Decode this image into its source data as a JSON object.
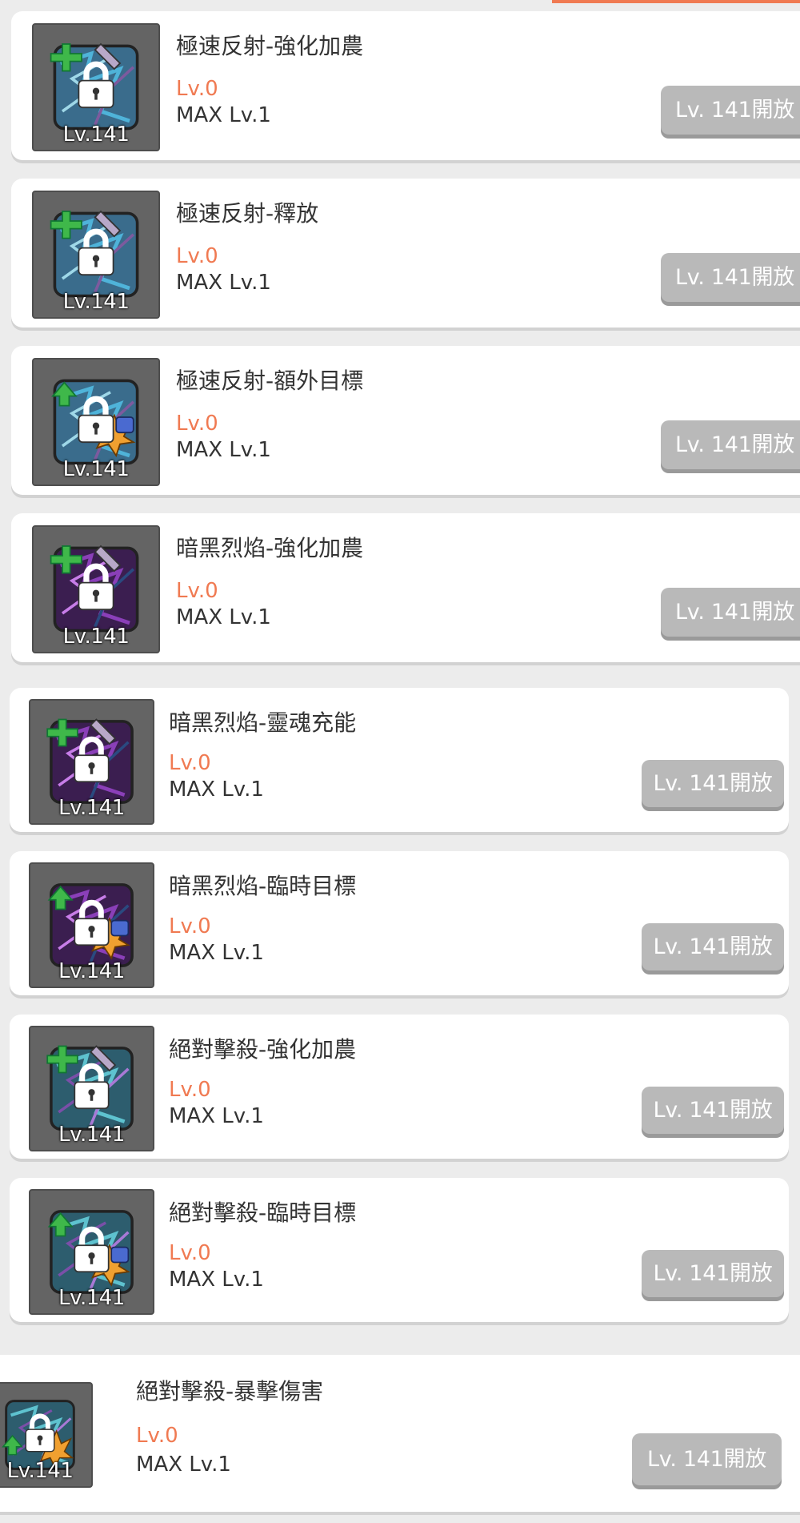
{
  "skills": [
    {
      "name": "極速反射-強化加農",
      "level": "Lv.0",
      "max_level": "MAX Lv.1",
      "unlock_label": "Lv. 141開放",
      "thumb_level": "Lv.141",
      "art": "blue-cross",
      "icon": "plus-arrow-locked-skill-icon"
    },
    {
      "name": "極速反射-釋放",
      "level": "Lv.0",
      "max_level": "MAX Lv.1",
      "unlock_label": "Lv. 141開放",
      "thumb_level": "Lv.141",
      "art": "blue-cross",
      "icon": "release-arrow-locked-skill-icon"
    },
    {
      "name": "極速反射-額外目標",
      "level": "Lv.0",
      "max_level": "MAX Lv.1",
      "unlock_label": "Lv. 141開放",
      "thumb_level": "Lv.141",
      "art": "blue-burst",
      "icon": "target-arrow-locked-skill-icon"
    },
    {
      "name": "暗黑烈焰-強化加農",
      "level": "Lv.0",
      "max_level": "MAX Lv.1",
      "unlock_label": "Lv. 141開放",
      "thumb_level": "Lv.141",
      "art": "purple-cross",
      "icon": "plus-arrow-locked-skill-icon"
    },
    {
      "name": "暗黑烈焰-靈魂充能",
      "level": "Lv.0",
      "max_level": "MAX Lv.1",
      "unlock_label": "Lv. 141開放",
      "thumb_level": "Lv.141",
      "art": "purple-cross",
      "icon": "charge-arrow-locked-skill-icon"
    },
    {
      "name": "暗黑烈焰-臨時目標",
      "level": "Lv.0",
      "max_level": "MAX Lv.1",
      "unlock_label": "Lv. 141開放",
      "thumb_level": "Lv.141",
      "art": "purple-burst",
      "icon": "target-arrow-locked-skill-icon"
    },
    {
      "name": "絕對擊殺-強化加農",
      "level": "Lv.0",
      "max_level": "MAX Lv.1",
      "unlock_label": "Lv. 141開放",
      "thumb_level": "Lv.141",
      "art": "teal-cross",
      "icon": "plus-arrow-locked-skill-icon"
    },
    {
      "name": "絕對擊殺-臨時目標",
      "level": "Lv.0",
      "max_level": "MAX Lv.1",
      "unlock_label": "Lv. 141開放",
      "thumb_level": "Lv.141",
      "art": "teal-burst",
      "icon": "target-arrow-locked-skill-icon"
    },
    {
      "name": "絕對擊殺-暴擊傷害",
      "level": "Lv.0",
      "max_level": "MAX Lv.1",
      "unlock_label": "Lv. 141開放",
      "thumb_level": "Lv.141",
      "art": "teal-fire",
      "icon": "critical-arrow-locked-skill-icon"
    }
  ],
  "colors": {
    "accent": "#f07a52",
    "button_disabled": "#b9b9b9",
    "thumb_bg": "#646464"
  }
}
